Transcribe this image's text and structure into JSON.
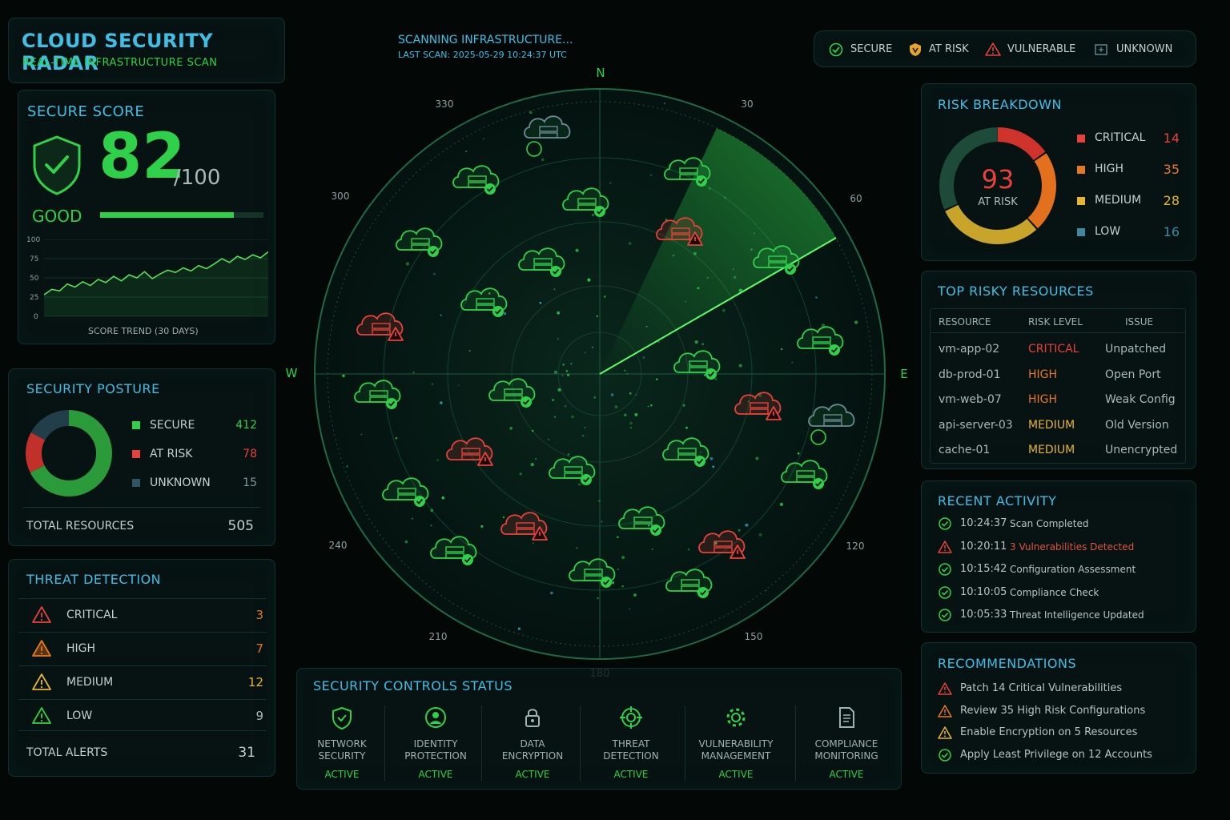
{
  "colors": {
    "secure": "#2fd14a",
    "critical": "#e8413a",
    "high": "#e8781d",
    "medium": "#e6b52a",
    "low": "#3d8aa0",
    "unknown": "#2c5566",
    "accent": "#3fbfe6"
  },
  "header": {
    "title": "CLOUD SECURITY RADAR",
    "subtitle": "REAL-TIME INFRASTRUCTURE SCAN"
  },
  "scan": {
    "status": "SCANNING INFRASTRUCTURE...",
    "last_scan": "LAST SCAN: 2025-05-29 10:24:37 UTC"
  },
  "legend": [
    {
      "label": "SECURE",
      "icon": "check-circle-icon"
    },
    {
      "label": "AT RISK",
      "icon": "shield-warning-icon"
    },
    {
      "label": "VULNERABLE",
      "icon": "warning-triangle-icon"
    },
    {
      "label": "UNKNOWN",
      "icon": "unknown-box-icon"
    }
  ],
  "score": {
    "title": "SECURE SCORE",
    "value": "82",
    "max": "/100",
    "rating": "GOOD",
    "progress_percent": 82,
    "y_ticks": [
      "100",
      "75",
      "50",
      "25",
      "0"
    ],
    "trend_label": "SCORE TREND (30 DAYS)",
    "trend": [
      28,
      35,
      33,
      42,
      38,
      45,
      40,
      48,
      44,
      52,
      46,
      54,
      50,
      58,
      49,
      55,
      60,
      57,
      63,
      59,
      66,
      62,
      68,
      75,
      70,
      78,
      74,
      80,
      76,
      84
    ]
  },
  "posture": {
    "title": "SECURITY POSTURE",
    "items": [
      {
        "label": "SECURE",
        "value": "412"
      },
      {
        "label": "AT RISK",
        "value": "78"
      },
      {
        "label": "UNKNOWN",
        "value": "15"
      }
    ],
    "total_label": "TOTAL RESOURCES",
    "total_value": "505"
  },
  "threats": {
    "title": "THREAT DETECTION",
    "items": [
      {
        "label": "CRITICAL",
        "value": "3"
      },
      {
        "label": "HIGH",
        "value": "7"
      },
      {
        "label": "MEDIUM",
        "value": "12"
      },
      {
        "label": "LOW",
        "value": "9"
      }
    ],
    "total_label": "TOTAL ALERTS",
    "total_value": "31"
  },
  "radar": {
    "n": "N",
    "e": "E",
    "s": "180",
    "w": "W",
    "degrees": [
      "330",
      "30",
      "300",
      "60",
      "240",
      "120",
      "210",
      "150"
    ]
  },
  "risk": {
    "title": "RISK BREAKDOWN",
    "total": "93",
    "total_label": "AT RISK",
    "items": [
      {
        "label": "CRITICAL",
        "value": "14"
      },
      {
        "label": "HIGH",
        "value": "35"
      },
      {
        "label": "MEDIUM",
        "value": "28"
      },
      {
        "label": "LOW",
        "value": "16"
      }
    ]
  },
  "risky": {
    "title": "TOP RISKY RESOURCES",
    "headers": [
      "RESOURCE",
      "RISK LEVEL",
      "ISSUE"
    ],
    "rows": [
      {
        "resource": "vm-app-02",
        "level": "CRITICAL",
        "issue": "Unpatched"
      },
      {
        "resource": "db-prod-01",
        "level": "HIGH",
        "issue": "Open Port"
      },
      {
        "resource": "vm-web-07",
        "level": "HIGH",
        "issue": "Weak Config"
      },
      {
        "resource": "api-server-03",
        "level": "MEDIUM",
        "issue": "Old Version"
      },
      {
        "resource": "cache-01",
        "level": "MEDIUM",
        "issue": "Unencrypted"
      }
    ]
  },
  "activity": {
    "title": "RECENT ACTIVITY",
    "items": [
      {
        "time": "10:24:37",
        "text": "Scan Completed",
        "status": "ok"
      },
      {
        "time": "10:20:11",
        "text": "3 Vulnerabilities Detected",
        "status": "alert"
      },
      {
        "time": "10:15:42",
        "text": "Configuration Assessment",
        "status": "ok"
      },
      {
        "time": "10:10:05",
        "text": "Compliance Check",
        "status": "ok"
      },
      {
        "time": "10:05:33",
        "text": "Threat Intelligence Updated",
        "status": "ok"
      }
    ]
  },
  "recs": {
    "title": "RECOMMENDATIONS",
    "items": [
      {
        "text": "Patch 14 Critical Vulnerabilities",
        "level": "critical"
      },
      {
        "text": "Review 35 High Risk Configurations",
        "level": "high"
      },
      {
        "text": "Enable Encryption on 5 Resources",
        "level": "medium"
      },
      {
        "text": "Apply Least Privilege on 12 Accounts",
        "level": "ok"
      }
    ]
  },
  "controls": {
    "title": "SECURITY CONTROLS STATUS",
    "items": [
      {
        "line1": "NETWORK",
        "line2": "SECURITY",
        "status": "ACTIVE",
        "icon": "shield-check-icon"
      },
      {
        "line1": "IDENTITY",
        "line2": "PROTECTION",
        "status": "ACTIVE",
        "icon": "user-circle-icon"
      },
      {
        "line1": "DATA",
        "line2": "ENCRYPTION",
        "status": "ACTIVE",
        "icon": "lock-icon"
      },
      {
        "line1": "THREAT",
        "line2": "DETECTION",
        "status": "ACTIVE",
        "icon": "crosshair-icon"
      },
      {
        "line1": "VULNERABILITY",
        "line2": "MANAGEMENT",
        "status": "ACTIVE",
        "icon": "gear-icon"
      },
      {
        "line1": "COMPLIANCE",
        "line2": "MONITORING",
        "status": "ACTIVE",
        "icon": "document-icon"
      }
    ]
  }
}
